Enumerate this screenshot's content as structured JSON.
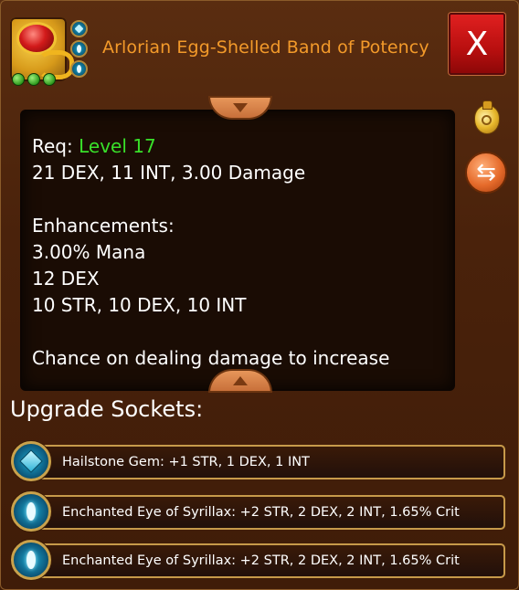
{
  "item": {
    "name": "Arlorian Egg-Shelled Band of Potency",
    "icon": "ruby-ring-icon",
    "pips": 3,
    "socket_indicators": [
      "hailstone-gem-icon",
      "eye-gem-icon",
      "eye-gem-icon"
    ]
  },
  "close_button": {
    "label": "X"
  },
  "description": {
    "req_label": "Req:",
    "req_value": "Level 17",
    "requirements": "21 DEX, 11 INT, 3.00 Damage",
    "enhancements_heading": "Enhancements:",
    "enhancements": [
      "3.00% Mana",
      "12 DEX",
      "10 STR, 10 DEX, 10 INT"
    ],
    "proc_text": "Chance on dealing damage to increase"
  },
  "sockets": {
    "heading": "Upgrade Sockets:",
    "items": [
      {
        "icon": "hailstone-gem-icon",
        "text": "Hailstone Gem: +1 STR, 1 DEX, 1 INT"
      },
      {
        "icon": "eye-gem-icon",
        "text": "Enchanted Eye of Syrillax: +2 STR, 2 DEX, 2 INT, 1.65% Crit"
      },
      {
        "icon": "eye-gem-icon",
        "text": "Enchanted Eye of Syrillax: +2 STR, 2 DEX, 2 INT, 1.65% Crit"
      }
    ]
  },
  "side_buttons": [
    "sell-bag-icon",
    "swap-arrows-icon"
  ],
  "colors": {
    "title": "#f39a2a",
    "level_requirement": "#39e02a",
    "close_button": "#c81414",
    "panel_background": "#4a220b"
  }
}
